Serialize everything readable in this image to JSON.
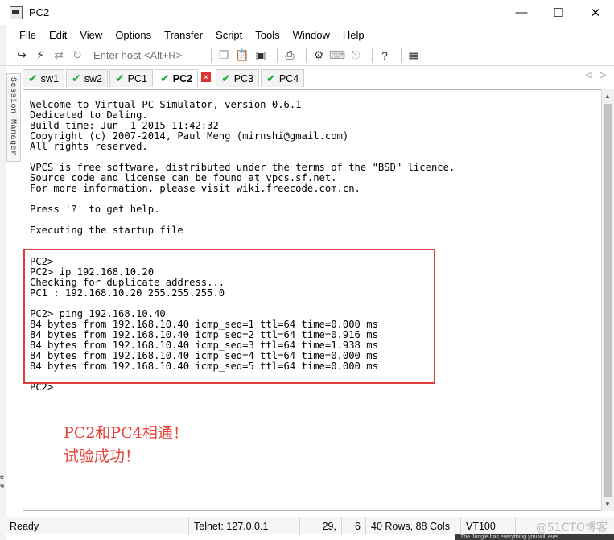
{
  "window": {
    "title": "PC2"
  },
  "menu": [
    "File",
    "Edit",
    "View",
    "Options",
    "Transfer",
    "Script",
    "Tools",
    "Window",
    "Help"
  ],
  "toolbar": {
    "host_placeholder": "Enter host <Alt+R>"
  },
  "session_manager": {
    "label": "Session Manager"
  },
  "tabs": [
    {
      "label": "sw1",
      "status": "connected"
    },
    {
      "label": "sw2",
      "status": "connected"
    },
    {
      "label": "PC1",
      "status": "connected"
    },
    {
      "label": "PC2",
      "status": "connected",
      "active": true
    },
    {
      "label": "PC3",
      "status": "connected"
    },
    {
      "label": "PC4",
      "status": "connected"
    }
  ],
  "terminal": {
    "lines": [
      "Welcome to Virtual PC Simulator, version 0.6.1",
      "Dedicated to Daling.",
      "Build time: Jun  1 2015 11:42:32",
      "Copyright (c) 2007-2014, Paul Meng (mirnshi@gmail.com)",
      "All rights reserved.",
      "",
      "VPCS is free software, distributed under the terms of the \"BSD\" licence.",
      "Source code and license can be found at vpcs.sf.net.",
      "For more information, please visit wiki.freecode.com.cn.",
      "",
      "Press '?' to get help.",
      "",
      "Executing the startup file",
      "",
      "",
      "PC2>",
      "PC2> ip 192.168.10.20",
      "Checking for duplicate address...",
      "PC1 : 192.168.10.20 255.255.255.0",
      "",
      "PC2> ping 192.168.10.40",
      "84 bytes from 192.168.10.40 icmp_seq=1 ttl=64 time=0.000 ms",
      "84 bytes from 192.168.10.40 icmp_seq=2 ttl=64 time=0.916 ms",
      "84 bytes from 192.168.10.40 icmp_seq=3 ttl=64 time=1.938 ms",
      "84 bytes from 192.168.10.40 icmp_seq=4 ttl=64 time=0.000 ms",
      "84 bytes from 192.168.10.40 icmp_seq=5 ttl=64 time=0.000 ms",
      "",
      "PC2>"
    ],
    "annotation": [
      "PC2和PC4相通！",
      "试验成功！"
    ],
    "annotation_color": "#e8413a",
    "highlight_color": "#e03c3c"
  },
  "status": {
    "ready": "Ready",
    "connection": "Telnet: 127.0.0.1",
    "row": "29,",
    "col": "6",
    "size": "40 Rows, 88 Cols",
    "emulation": "VT100"
  },
  "watermark": "@51CTO博客",
  "bottom_strip": "The Jungle has everything you will ever",
  "left_edge": {
    "top": "e",
    "bottom": "9"
  }
}
